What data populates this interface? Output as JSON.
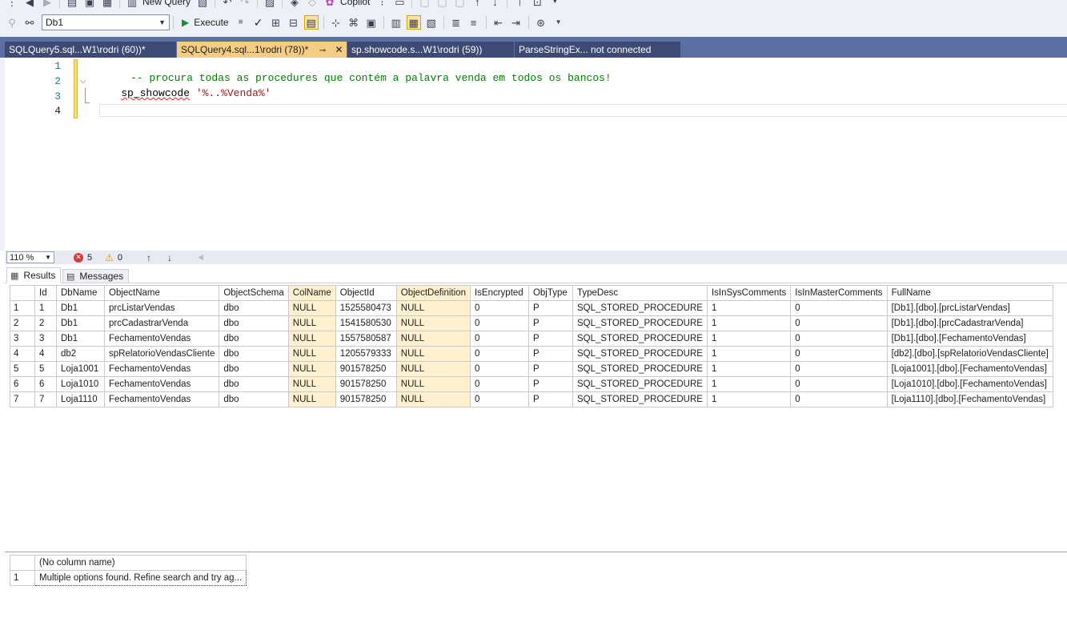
{
  "toolbar": {
    "new_query_label": "New Query",
    "copilot_label": "Copilot",
    "database_value": "Db1",
    "execute_label": "Execute"
  },
  "tabs": [
    {
      "label": "SQLQuery5.sql...W1\\rodri (60))*",
      "active": false
    },
    {
      "label": "SQLQuery4.sql...1\\rodri (78))*",
      "active": true,
      "pin": "⊸",
      "close": "✕"
    },
    {
      "label": "sp.showcode.s...W1\\rodri (59))",
      "active": false
    },
    {
      "label": "ParseStringEx... not connected",
      "active": false
    }
  ],
  "editor": {
    "line_numbers": [
      "1",
      "2",
      "3",
      "4"
    ],
    "line1_comment": " -- procura todas as procedures que contém a palavra venda em todos os bancos!",
    "line2_proc": "sp_showcode",
    "line2_arg": "'%..%Venda%'"
  },
  "status": {
    "zoom": "110 %",
    "errors": "5",
    "warnings": "0"
  },
  "results_tabs": {
    "results_label": "Results",
    "messages_label": "Messages"
  },
  "grid1": {
    "columns": [
      "Id",
      "DbName",
      "ObjectName",
      "ObjectSchema",
      "ColName",
      "ObjectId",
      "ObjectDefinition",
      "IsEncrypted",
      "ObjType",
      "TypeDesc",
      "IsInSysComments",
      "IsInMasterComments",
      "FullName"
    ],
    "rows": [
      [
        "1",
        "Db1",
        "prcListarVendas",
        "dbo",
        "NULL",
        "1525580473",
        "NULL",
        "0",
        "P",
        "SQL_STORED_PROCEDURE",
        "1",
        "0",
        "[Db1].[dbo].[prcListarVendas]"
      ],
      [
        "2",
        "Db1",
        "prcCadastrarVenda",
        "dbo",
        "NULL",
        "1541580530",
        "NULL",
        "0",
        "P",
        "SQL_STORED_PROCEDURE",
        "1",
        "0",
        "[Db1].[dbo].[prcCadastrarVenda]"
      ],
      [
        "3",
        "Db1",
        "FechamentoVendas",
        "dbo",
        "NULL",
        "1557580587",
        "NULL",
        "0",
        "P",
        "SQL_STORED_PROCEDURE",
        "1",
        "0",
        "[Db1].[dbo].[FechamentoVendas]"
      ],
      [
        "4",
        "db2",
        "spRelatorioVendasCliente",
        "dbo",
        "NULL",
        "1205579333",
        "NULL",
        "0",
        "P",
        "SQL_STORED_PROCEDURE",
        "1",
        "0",
        "[db2].[dbo].[spRelatorioVendasCliente]"
      ],
      [
        "5",
        "Loja1001",
        "FechamentoVendas",
        "dbo",
        "NULL",
        "901578250",
        "NULL",
        "0",
        "P",
        "SQL_STORED_PROCEDURE",
        "1",
        "0",
        "[Loja1001].[dbo].[FechamentoVendas]"
      ],
      [
        "6",
        "Loja1010",
        "FechamentoVendas",
        "dbo",
        "NULL",
        "901578250",
        "NULL",
        "0",
        "P",
        "SQL_STORED_PROCEDURE",
        "1",
        "0",
        "[Loja1010].[dbo].[FechamentoVendas]"
      ],
      [
        "7",
        "Loja1110",
        "FechamentoVendas",
        "dbo",
        "NULL",
        "901578250",
        "NULL",
        "0",
        "P",
        "SQL_STORED_PROCEDURE",
        "1",
        "0",
        "[Loja1110].[dbo].[FechamentoVendas]"
      ]
    ]
  },
  "grid2": {
    "columns": [
      "(No column name)"
    ],
    "rows": [
      [
        "Multiple options found. Refine search and try ag..."
      ]
    ]
  }
}
